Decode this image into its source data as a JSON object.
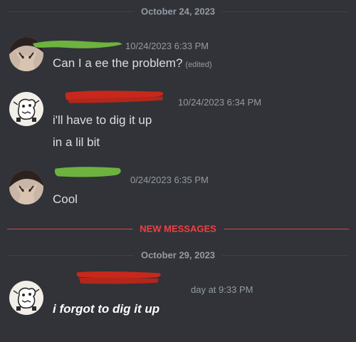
{
  "dividers": {
    "date1": "October 24, 2023",
    "new_messages": "NEW MESSAGES",
    "date2": "October 29, 2023"
  },
  "messages": [
    {
      "user": "redacted",
      "avatar": "anime-avatar",
      "timestamp": "10/24/2023 6:33 PM",
      "text": "Can I a ee the problem?",
      "edited": "(edited)",
      "scribble_color": "#6db33f"
    },
    {
      "user": "redacted",
      "avatar": "creature-avatar",
      "timestamp": "10/24/2023 6:34 PM",
      "text": "i'll have to dig it up",
      "scribble_color": "#c8281b"
    },
    {
      "text": "in a lil bit"
    },
    {
      "user": "redacted",
      "avatar": "anime-avatar",
      "timestamp": "0/24/2023 6:35 PM",
      "text": "Cool",
      "scribble_color": "#6db33f"
    },
    {
      "user": "redacted",
      "avatar": "creature-avatar",
      "timestamp": "day at 9:33 PM",
      "text": "i forgot to dig it up",
      "scribble_color": "#c8281b"
    }
  ]
}
